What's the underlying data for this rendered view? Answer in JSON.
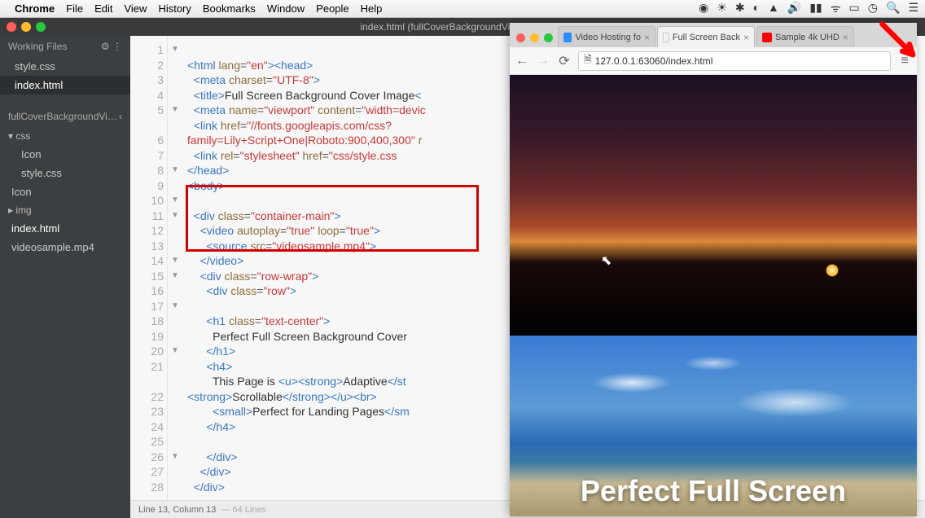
{
  "menubar": {
    "app": "Chrome",
    "items": [
      "File",
      "Edit",
      "View",
      "History",
      "Bookmarks",
      "Window",
      "People",
      "Help"
    ],
    "right_icons": [
      "check-circle",
      "sun",
      "asterisk",
      "cloud",
      "drive",
      "volume",
      "signal",
      "wifi",
      "battery",
      "clock",
      "search",
      "menu"
    ]
  },
  "brackets": {
    "window_title": "index.html (fullCoverBackgroundVideo) — Brac",
    "sidebar": {
      "working_files_label": "Working Files",
      "working_files": [
        {
          "name": "style.css",
          "active": false
        },
        {
          "name": "index.html",
          "active": true
        }
      ],
      "project_label": "fullCoverBackgroundVideo",
      "tree": [
        {
          "name": "css",
          "type": "folder"
        },
        {
          "name": "Icon",
          "type": "file",
          "indent": 1
        },
        {
          "name": "style.css",
          "type": "file",
          "indent": 1
        },
        {
          "name": "Icon",
          "type": "file"
        },
        {
          "name": "img",
          "type": "folder"
        },
        {
          "name": "index.html",
          "type": "file",
          "sel": true
        },
        {
          "name": "videosample.mp4",
          "type": "file"
        }
      ]
    },
    "code": {
      "line_numbers": [
        "1",
        "2",
        "3",
        "4",
        "5",
        "",
        "6",
        "7",
        "8",
        "9",
        "10",
        "11",
        "12",
        "13",
        "14",
        "15",
        "16",
        "17",
        "18",
        "19",
        "20",
        "21",
        "",
        "22",
        "23",
        "24",
        "25",
        "26",
        "27",
        "28"
      ],
      "fold_markers": [
        "▼",
        "",
        "",
        "",
        "▼",
        "",
        "",
        "",
        "▼",
        "",
        "▼",
        "▼",
        "",
        "",
        "▼",
        "▼",
        "",
        "▼",
        "",
        "",
        "▼",
        "",
        "",
        "",
        "",
        "",
        "",
        "▼",
        "",
        ""
      ]
    },
    "statusbar": {
      "left": "Line 13, Column 13",
      "right": "64 Lines"
    }
  },
  "chrome": {
    "tabs": [
      {
        "label": "Video Hosting fo",
        "favicon": "#2a8cff",
        "active": false
      },
      {
        "label": "Full Screen Back",
        "favicon": "#fff",
        "active": true
      },
      {
        "label": "Sample 4k UHD",
        "favicon": "#ff0000",
        "active": false
      }
    ],
    "url": "127.0.0.1:63060/index.html",
    "overlay_text": "Perfect Full Screen"
  }
}
